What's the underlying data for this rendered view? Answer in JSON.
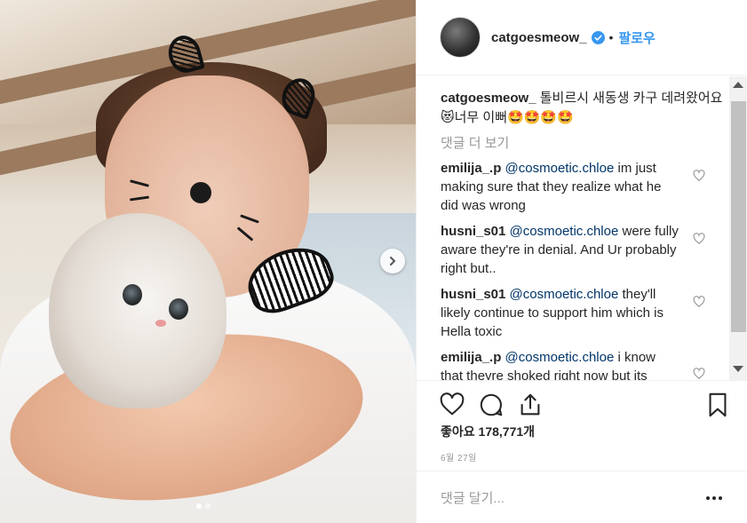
{
  "post": {
    "username": "catgoesmeow_",
    "bullet": "•",
    "follow_label": "팔로우",
    "caption_text": "톨비르시 새동생 카구 데려왔어요😻너무 이뻐🤩🤩🤩🤩",
    "view_more": "댓글 더 보기"
  },
  "comments": [
    {
      "user": "emilija_.p",
      "mention": "@cosmoetic.chloe",
      "text": "im just making sure that they realize what he did was wrong"
    },
    {
      "user": "husni_s01",
      "mention": "@cosmoetic.chloe",
      "text": "were fully aware they're in denial. And Ur probably right but.."
    },
    {
      "user": "husni_s01",
      "mention": "@cosmoetic.chloe",
      "text": "they'll likely continue to support him which is Hella toxic"
    },
    {
      "user": "emilija_.p",
      "mention": "@cosmoetic.chloe",
      "text": "i know that theyre shoked right now but its gonna cause a lot of drama id they"
    }
  ],
  "stats": {
    "likes_label": "좋아요",
    "likes_count": "178,771개",
    "date": "6월 27일"
  },
  "composer": {
    "placeholder": "댓글 달기..."
  },
  "carousel": {
    "total": 2,
    "active_index": 0
  },
  "colors": {
    "accent": "#3897f0",
    "mention": "#003569",
    "muted": "#999999",
    "text": "#262626"
  },
  "icons": [
    "verified-badge-icon",
    "like-heart-icon",
    "comment-bubble-icon",
    "share-icon",
    "bookmark-icon",
    "chevron-right-icon",
    "more-options-icon"
  ]
}
